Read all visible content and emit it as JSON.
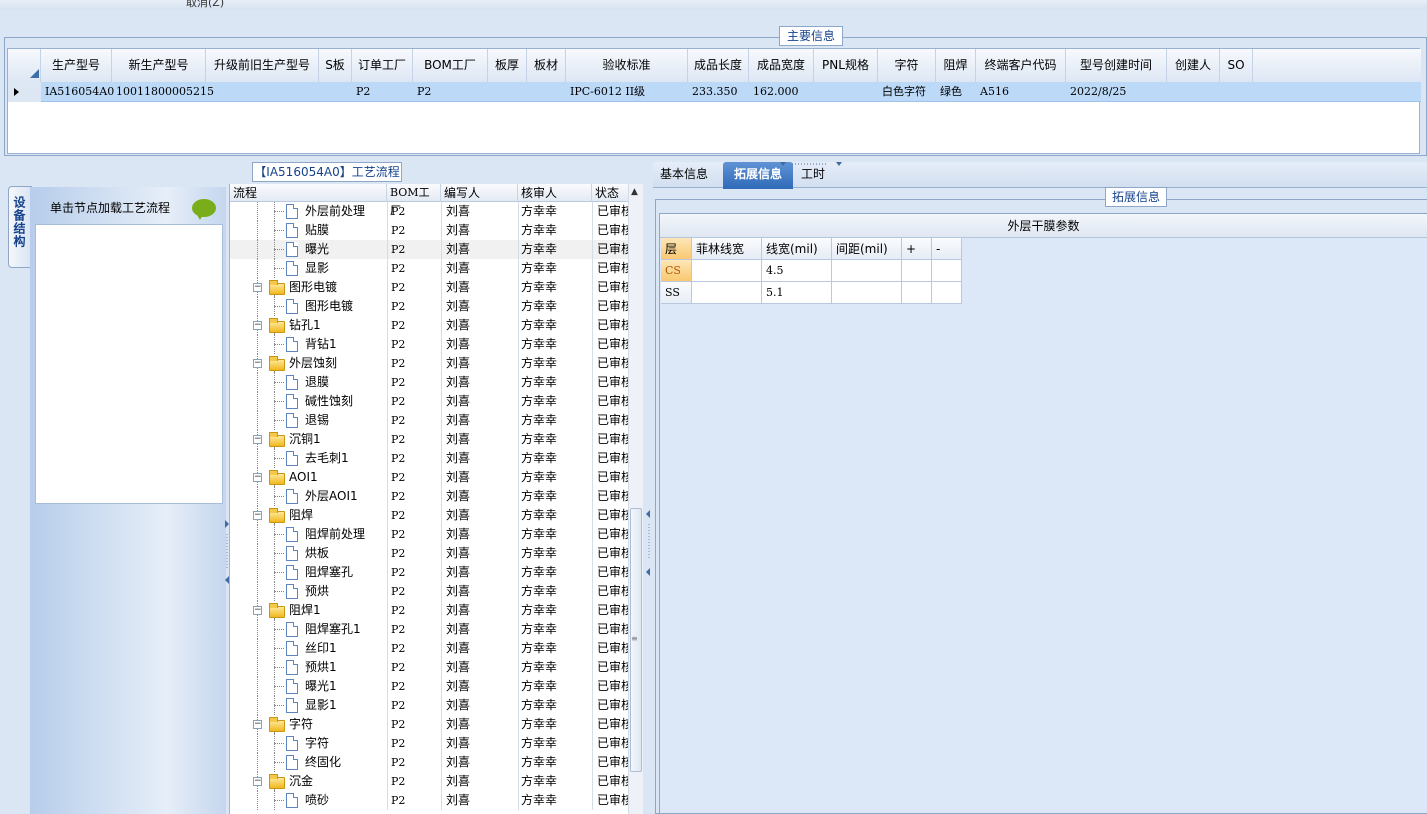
{
  "toolbar": {
    "cancel_label": "取消(Z)"
  },
  "main_info": {
    "title": "主要信息",
    "columns": [
      "生产型号",
      "新生产型号",
      "升级前旧生产型号",
      "S板",
      "订单工厂",
      "BOM工厂",
      "板厚",
      "板材",
      "验收标准",
      "成品长度",
      "成品宽度",
      "PNL规格",
      "字符",
      "阻焊",
      "终端客户代码",
      "型号创建时间",
      "创建人",
      "SO"
    ],
    "row": [
      "IA516054A0",
      "10011800005215",
      "",
      "",
      "P2",
      "P2",
      "",
      "",
      "IPC-6012 II级",
      "233.350",
      "162.000",
      "",
      "白色字符",
      "绿色",
      "A516",
      "2022/8/25",
      "",
      ""
    ]
  },
  "left_nav": {
    "vertical_tab": "设备结构",
    "load_label": "单击节点加载工艺流程"
  },
  "flow": {
    "title": "【IA516054A0】工艺流程",
    "columns": [
      "流程",
      "BOM工厂",
      "编写人",
      "核审人",
      "状态"
    ],
    "rows": [
      {
        "type": "file",
        "level": 2,
        "name": "外层前处理",
        "bom": "P2",
        "writer": "刘喜",
        "reviewer": "方幸幸",
        "status": "已审核"
      },
      {
        "type": "file",
        "level": 2,
        "name": "贴膜",
        "bom": "P2",
        "writer": "刘喜",
        "reviewer": "方幸幸",
        "status": "已审核"
      },
      {
        "type": "file",
        "level": 2,
        "name": "曝光",
        "bom": "P2",
        "writer": "刘喜",
        "reviewer": "方幸幸",
        "status": "已审核"
      },
      {
        "type": "file",
        "level": 2,
        "name": "显影",
        "bom": "P2",
        "writer": "刘喜",
        "reviewer": "方幸幸",
        "status": "已审核"
      },
      {
        "type": "folder",
        "level": 1,
        "name": "图形电镀",
        "bom": "P2",
        "writer": "刘喜",
        "reviewer": "方幸幸",
        "status": "已审核"
      },
      {
        "type": "file",
        "level": 2,
        "name": "图形电镀",
        "bom": "P2",
        "writer": "刘喜",
        "reviewer": "方幸幸",
        "status": "已审核"
      },
      {
        "type": "folder",
        "level": 1,
        "name": "钻孔1",
        "bom": "P2",
        "writer": "刘喜",
        "reviewer": "方幸幸",
        "status": "已审核"
      },
      {
        "type": "file",
        "level": 2,
        "name": "背钻1",
        "bom": "P2",
        "writer": "刘喜",
        "reviewer": "方幸幸",
        "status": "已审核"
      },
      {
        "type": "folder",
        "level": 1,
        "name": "外层蚀刻",
        "bom": "P2",
        "writer": "刘喜",
        "reviewer": "方幸幸",
        "status": "已审核"
      },
      {
        "type": "file",
        "level": 2,
        "name": "退膜",
        "bom": "P2",
        "writer": "刘喜",
        "reviewer": "方幸幸",
        "status": "已审核"
      },
      {
        "type": "file",
        "level": 2,
        "name": "碱性蚀刻",
        "bom": "P2",
        "writer": "刘喜",
        "reviewer": "方幸幸",
        "status": "已审核"
      },
      {
        "type": "file",
        "level": 2,
        "name": "退锡",
        "bom": "P2",
        "writer": "刘喜",
        "reviewer": "方幸幸",
        "status": "已审核"
      },
      {
        "type": "folder",
        "level": 1,
        "name": "沉铜1",
        "bom": "P2",
        "writer": "刘喜",
        "reviewer": "方幸幸",
        "status": "已审核"
      },
      {
        "type": "file",
        "level": 2,
        "name": "去毛刺1",
        "bom": "P2",
        "writer": "刘喜",
        "reviewer": "方幸幸",
        "status": "已审核"
      },
      {
        "type": "folder",
        "level": 1,
        "name": "AOI1",
        "bom": "P2",
        "writer": "刘喜",
        "reviewer": "方幸幸",
        "status": "已审核"
      },
      {
        "type": "file",
        "level": 2,
        "name": "外层AOI1",
        "bom": "P2",
        "writer": "刘喜",
        "reviewer": "方幸幸",
        "status": "已审核"
      },
      {
        "type": "folder",
        "level": 1,
        "name": "阻焊",
        "bom": "P2",
        "writer": "刘喜",
        "reviewer": "方幸幸",
        "status": "已审核"
      },
      {
        "type": "file",
        "level": 2,
        "name": "阻焊前处理",
        "bom": "P2",
        "writer": "刘喜",
        "reviewer": "方幸幸",
        "status": "已审核"
      },
      {
        "type": "file",
        "level": 2,
        "name": "烘板",
        "bom": "P2",
        "writer": "刘喜",
        "reviewer": "方幸幸",
        "status": "已审核"
      },
      {
        "type": "file",
        "level": 2,
        "name": "阻焊塞孔",
        "bom": "P2",
        "writer": "刘喜",
        "reviewer": "方幸幸",
        "status": "已审核"
      },
      {
        "type": "file",
        "level": 2,
        "name": "预烘",
        "bom": "P2",
        "writer": "刘喜",
        "reviewer": "方幸幸",
        "status": "已审核"
      },
      {
        "type": "folder",
        "level": 1,
        "name": "阻焊1",
        "bom": "P2",
        "writer": "刘喜",
        "reviewer": "方幸幸",
        "status": "已审核"
      },
      {
        "type": "file",
        "level": 2,
        "name": "阻焊塞孔1",
        "bom": "P2",
        "writer": "刘喜",
        "reviewer": "方幸幸",
        "status": "已审核"
      },
      {
        "type": "file",
        "level": 2,
        "name": "丝印1",
        "bom": "P2",
        "writer": "刘喜",
        "reviewer": "方幸幸",
        "status": "已审核"
      },
      {
        "type": "file",
        "level": 2,
        "name": "预烘1",
        "bom": "P2",
        "writer": "刘喜",
        "reviewer": "方幸幸",
        "status": "已审核"
      },
      {
        "type": "file",
        "level": 2,
        "name": "曝光1",
        "bom": "P2",
        "writer": "刘喜",
        "reviewer": "方幸幸",
        "status": "已审核"
      },
      {
        "type": "file",
        "level": 2,
        "name": "显影1",
        "bom": "P2",
        "writer": "刘喜",
        "reviewer": "方幸幸",
        "status": "已审核"
      },
      {
        "type": "folder",
        "level": 1,
        "name": "字符",
        "bom": "P2",
        "writer": "刘喜",
        "reviewer": "方幸幸",
        "status": "已审核"
      },
      {
        "type": "file",
        "level": 2,
        "name": "字符",
        "bom": "P2",
        "writer": "刘喜",
        "reviewer": "方幸幸",
        "status": "已审核"
      },
      {
        "type": "file",
        "level": 2,
        "name": "终固化",
        "bom": "P2",
        "writer": "刘喜",
        "reviewer": "方幸幸",
        "status": "已审核"
      },
      {
        "type": "folder",
        "level": 1,
        "name": "沉金",
        "bom": "P2",
        "writer": "刘喜",
        "reviewer": "方幸幸",
        "status": "已审核"
      },
      {
        "type": "file",
        "level": 2,
        "name": "喷砂",
        "bom": "P2",
        "writer": "刘喜",
        "reviewer": "方幸幸",
        "status": "已审核"
      }
    ]
  },
  "right_tabs": {
    "basic": "基本信息",
    "extended": "拓展信息",
    "hours": "工时"
  },
  "extended": {
    "title": "拓展信息",
    "table_title": "外层干膜参数",
    "columns": [
      "层",
      "菲林线宽",
      "线宽(mil)",
      "间距(mil)",
      "+",
      "-"
    ],
    "rows": [
      [
        "CS",
        "",
        "4.5",
        "",
        "",
        ""
      ],
      [
        "SS",
        "",
        "5.1",
        "",
        "",
        ""
      ]
    ]
  },
  "colors": {
    "selected_row": "#bcd9f7",
    "active_tab": "#3d75c2",
    "panel_bg": "#dbe6f4"
  }
}
